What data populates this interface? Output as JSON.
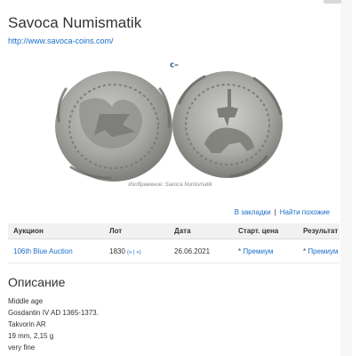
{
  "header": {
    "title": "Savoca Numismatik",
    "site_url": "http://www.savoca-coins.com/"
  },
  "image": {
    "caption": "Изображение: Savoca Numismatik"
  },
  "actions": {
    "bookmark": "В закладки",
    "separator": "|",
    "similar": "Найти похожие"
  },
  "table": {
    "headers": [
      "Аукцион",
      "Лот",
      "Дата",
      "Старт. цена",
      "Результат"
    ],
    "row": {
      "auction": "106th Blue Auction",
      "lot": "1830",
      "lot_links": "(« | »)",
      "date": "26.06.2021",
      "start_price": "Премиум",
      "result": "Премиум",
      "star": "*"
    }
  },
  "description": {
    "heading": "Описание",
    "lines": [
      "Middle age",
      "Gosdantin IV AD 1365-1373.",
      "Takvorin AR",
      "19 mm, 2,15 g",
      "very fine"
    ]
  },
  "colors": {
    "link": "#1a6ec8",
    "header_bg": "#f1f1f1",
    "coin_silver": "#a9aaa6"
  }
}
